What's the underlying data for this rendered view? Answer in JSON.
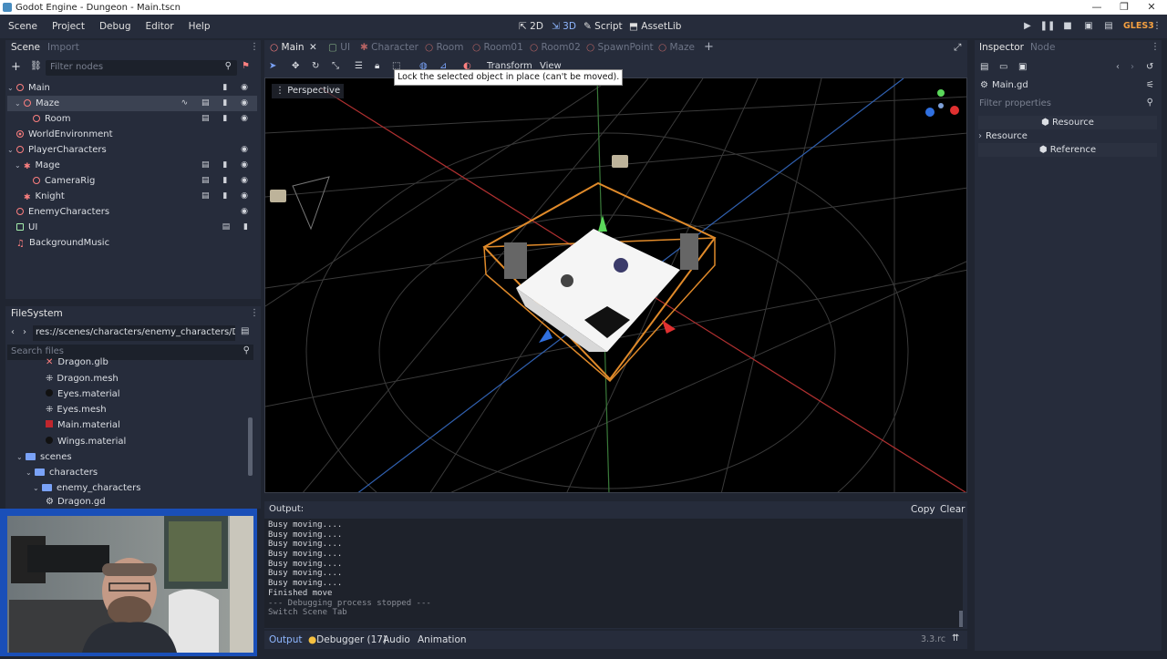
{
  "window": {
    "title": "Godot Engine - Dungeon - Main.tscn",
    "minimize": "—",
    "maximize": "❐",
    "close": "✕"
  },
  "menu": {
    "items": [
      "Scene",
      "Project",
      "Debug",
      "Editor",
      "Help"
    ]
  },
  "modes": {
    "m2d": "2D",
    "m3d": "3D",
    "script": "Script",
    "assetlib": "AssetLib"
  },
  "renderer": "GLES3",
  "scene_panel": {
    "tab_scene": "Scene",
    "tab_import": "Import",
    "filter_placeholder": "Filter nodes",
    "nodes": [
      {
        "label": "Main"
      },
      {
        "label": "Maze"
      },
      {
        "label": "Room"
      },
      {
        "label": "WorldEnvironment"
      },
      {
        "label": "PlayerCharacters"
      },
      {
        "label": "Mage"
      },
      {
        "label": "CameraRig"
      },
      {
        "label": "Knight"
      },
      {
        "label": "EnemyCharacters"
      },
      {
        "label": "UI"
      },
      {
        "label": "BackgroundMusic"
      }
    ]
  },
  "filesystem": {
    "title": "FileSystem",
    "path": "res://scenes/characters/enemy_characters/Drag",
    "search_placeholder": "Search files",
    "items": [
      {
        "label": "Dragon.glb"
      },
      {
        "label": "Dragon.mesh"
      },
      {
        "label": "Eyes.material"
      },
      {
        "label": "Eyes.mesh"
      },
      {
        "label": "Main.material"
      },
      {
        "label": "Wings.material"
      },
      {
        "label": "scenes"
      },
      {
        "label": "characters"
      },
      {
        "label": "enemy_characters"
      },
      {
        "label": "Dragon.gd"
      }
    ]
  },
  "editor_tabs": [
    {
      "label": "Main"
    },
    {
      "label": "UI"
    },
    {
      "label": "Character"
    },
    {
      "label": "Room"
    },
    {
      "label": "Room01"
    },
    {
      "label": "Room02"
    },
    {
      "label": "SpawnPoint"
    },
    {
      "label": "Maze"
    }
  ],
  "toolbar": {
    "transform": "Transform",
    "view": "View"
  },
  "tooltip": "Lock the selected object in place (can't be moved).",
  "viewport": {
    "perspective": "Perspective"
  },
  "output": {
    "label": "Output:",
    "copy": "Copy",
    "clear": "Clear",
    "lines": [
      {
        "text": "Busy moving...."
      },
      {
        "text": "Busy moving...."
      },
      {
        "text": "Busy moving...."
      },
      {
        "text": "Busy moving...."
      },
      {
        "text": "Busy moving...."
      },
      {
        "text": "Busy moving...."
      },
      {
        "text": "Busy moving...."
      },
      {
        "text": "Finished move"
      },
      {
        "text": "--- Debugging process stopped ---"
      },
      {
        "text": "Switch Scene Tab"
      }
    ]
  },
  "bottom_tabs": {
    "output": "Output",
    "debugger": "Debugger (17)",
    "audio": "Audio",
    "animation": "Animation",
    "version": "3.3.rc"
  },
  "inspector": {
    "tab_inspector": "Inspector",
    "tab_node": "Node",
    "file": "Main.gd",
    "filter_placeholder": "Filter properties",
    "resource_header": "Resource",
    "resource_section": "Resource",
    "reference_header": "Reference"
  }
}
